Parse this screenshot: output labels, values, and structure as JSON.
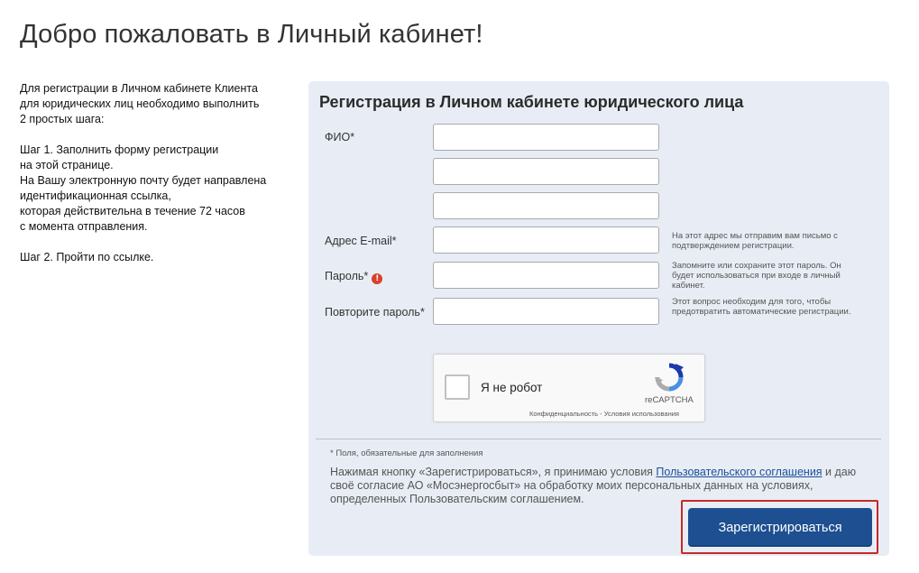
{
  "page": {
    "title": "Добро пожаловать в Личный кабинет!"
  },
  "instructions": {
    "intro": [
      "Для регистрации в Личном кабинете Клиента",
      "для юридических лиц необходимо выполнить",
      "2 простых шага:"
    ],
    "step1": [
      "Шаг 1. Заполнить форму регистрации",
      "на этой странице.",
      "На Вашу электронную почту будет направлена",
      "идентификационная ссылка,",
      "которая действительна в течение 72 часов",
      "с момента отправления."
    ],
    "step2": "Шаг 2. Пройти по ссылке."
  },
  "form": {
    "title": "Регистрация в Личном кабинете юридического лица",
    "fio_label": "ФИО*",
    "fio_values": [
      "",
      "",
      ""
    ],
    "email_label": "Адрес E-mail*",
    "email_value": "",
    "email_hint": "На этот адрес мы отправим вам письмо с подтверждением регистрации.",
    "password_label": "Пароль*",
    "password_value": "",
    "password_warning_icon": "exclamation-circle-icon",
    "password_hint": "Запомните или сохраните этот пароль. Он будет использоваться при входе в личный кабинет.",
    "repeat_label": "Повторите пароль*",
    "repeat_value": "",
    "repeat_hint": "Этот вопрос необходим для того, чтобы предотвратить автоматические регистрации.",
    "captcha": {
      "label": "Я не робот",
      "brand": "reCAPTCHA",
      "privacy": "Конфиденциальность",
      "separator": " - ",
      "terms": "Условия использования",
      "icon": "recaptcha-logo-icon"
    },
    "required_note": "* Поля, обязательные для заполнения",
    "consent_before": "Нажимая кнопку «Зарегистрироваться», я принимаю условия ",
    "consent_link": "Пользовательского соглашения",
    "consent_after": " и даю своё согласие АО «Мосэнергосбыт» на обработку моих персональных данных на условиях, определенных Пользовательским соглашением.",
    "register_button": "Зарегистрироваться"
  },
  "colors": {
    "panel_bg": "#e8edf5",
    "button_bg": "#1d4f91",
    "highlight_border": "#c62828",
    "link": "#1a4f9c",
    "warning": "#d9412b"
  }
}
